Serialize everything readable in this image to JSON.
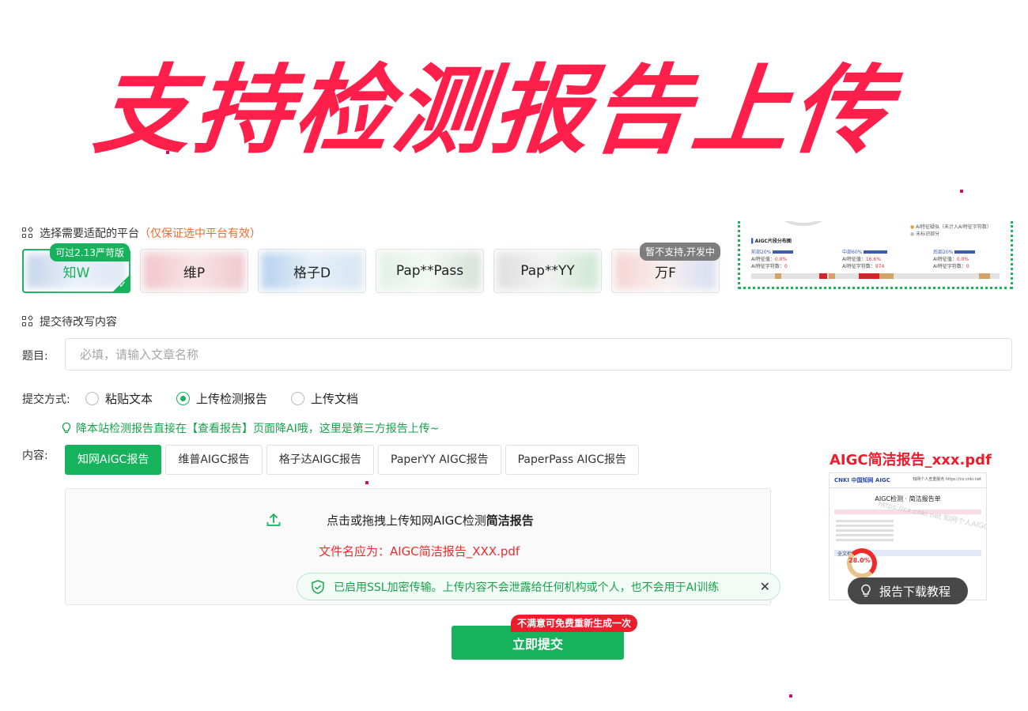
{
  "banner": {
    "headline": "支持检测报告上传"
  },
  "platform_section": {
    "title": "选择需要适配的平台",
    "hint": "（仅保证选中平台有效）",
    "items": [
      {
        "name": "知W",
        "tag": "可过2.13严苛版",
        "selected": true
      },
      {
        "name": "维P"
      },
      {
        "name": "格子D"
      },
      {
        "name": "Pap**Pass"
      },
      {
        "name": "Pap**YY"
      },
      {
        "name": "万F",
        "tag": "暂不支持,开发中"
      }
    ]
  },
  "preview_top": {
    "legend1": "AI特征疑似（未计入AI特征字符数）",
    "legend2": "未标识部分",
    "section": "AIGC片段分布图",
    "segments": [
      "前部20%",
      "中部60%",
      "后部20%"
    ],
    "rows": [
      {
        "a": "AI特征值：",
        "av": "0.0%",
        "b": "AI特征值：",
        "bv": "16.6%",
        "c": "AI特征值：",
        "cv": "0.0%"
      },
      {
        "a": "AI特征字符数：",
        "av": "0",
        "b": "AI特征字符数：",
        "bv": "974",
        "c": "AI特征字符数：",
        "cv": "0"
      }
    ]
  },
  "content_section": {
    "title": "提交待改写内容"
  },
  "form": {
    "title_label": "题目:",
    "title_placeholder": "必填，请输入文章名称",
    "method_label": "提交方式:",
    "methods": [
      "粘贴文本",
      "上传检测报告",
      "上传文档"
    ],
    "selected_method": "上传检测报告",
    "tip": "降本站检测报告直接在【查看报告】页面降AI哦，这里是第三方报告上传~",
    "content_label": "内容:",
    "tabs": [
      "知网AIGC报告",
      "维普AIGC报告",
      "格子达AIGC报告",
      "PaperYY AIGC报告",
      "PaperPass AIGC报告"
    ],
    "active_tab": "知网AIGC报告",
    "upload_prefix": "点击或拖拽上传知网AIGC检测",
    "upload_bold": "简洁报告",
    "upload_filename": "文件名应为：AIGC简洁报告_XXX.pdf",
    "ssl_notice": "已启用SSL加密传输。上传内容不会泄露给任何机构或个人，也不会用于AI训练",
    "submit_label": "立即提交",
    "submit_badge": "不满意可免费重新生成一次"
  },
  "report_sample": {
    "filename": "AIGC简洁报告_xxx.pdf",
    "head_left": "CNKI 中国知网 AIGC",
    "head_right": "知网个人查重服务 https://cx.cnki.net",
    "doc_title": "AIGC检测 · 简洁报告单",
    "watermark": "https://cx.cnki.net 知网个人AIGC检测服务",
    "section": "全文检测结果",
    "percent": "28.0%",
    "tutorial": "报告下载教程"
  },
  "colors": {
    "brand_green": "#16b35c",
    "banner_red": "#ff1f4b",
    "warn_red": "#ef2a2a",
    "hint_orange": "#f26a2a"
  }
}
